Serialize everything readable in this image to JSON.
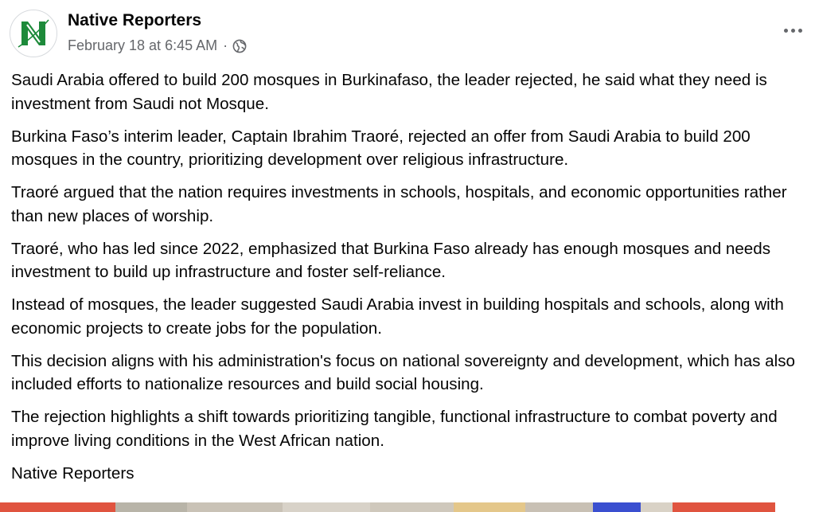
{
  "page": {
    "name": "Native Reporters",
    "timestamp": "February 18 at 6:45 AM",
    "separator": "·",
    "privacy_icon": "globe-icon",
    "more_icon": "more-horizontal-icon",
    "avatar_icon": "native-reporters-logo-icon"
  },
  "colors": {
    "name_text": "#050505",
    "meta_text": "#65676b",
    "logo_green": "#1d8a3a",
    "strip_red": "#e0543f"
  },
  "post": {
    "paragraphs": [
      "Saudi Arabia offered to build 200 mosques in Burkinafaso, the leader rejected, he said what they need is investment from Saudi not Mosque.",
      "Burkina Faso’s interim leader, Captain Ibrahim Traoré, rejected an offer from Saudi Arabia to build 200 mosques in the country, prioritizing development over religious infrastructure.",
      "Traoré argued that the nation requires investments in schools, hospitals, and economic opportunities rather than new places of worship.",
      "Traoré, who has led since 2022, emphasized that Burkina Faso already has enough mosques and needs investment to build up infrastructure and foster self-reliance.",
      "Instead of mosques, the leader suggested Saudi Arabia invest in building hospitals and schools, along with economic projects to create jobs for the population.",
      "This decision aligns with his administration's focus on national sovereignty and development, which has also included efforts to nationalize resources and build social housing.",
      "The rejection highlights a shift towards prioritizing tangible, functional infrastructure to combat poverty and improve living conditions in the West African nation.",
      "Native Reporters"
    ]
  }
}
